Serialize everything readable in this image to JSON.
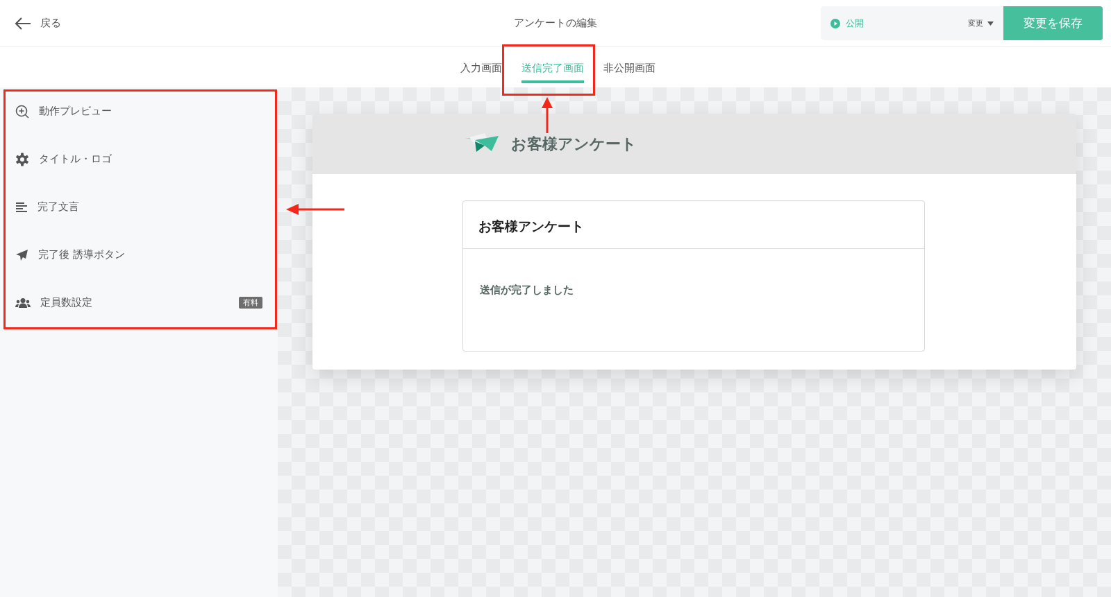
{
  "header": {
    "back": "戻る",
    "title": "アンケートの編集",
    "status": {
      "label": "公開",
      "change": "変更"
    },
    "save": "変更を保存"
  },
  "tabs": [
    {
      "label": "入力画面",
      "selected": false
    },
    {
      "label": "送信完了画面",
      "selected": true
    },
    {
      "label": "非公開画面",
      "selected": false
    }
  ],
  "sidebar": {
    "items": [
      {
        "kind": "preview",
        "label": "動作プレビュー"
      },
      {
        "kind": "settings",
        "label": "タイトル・ロゴ"
      },
      {
        "kind": "text",
        "label": "完了文言"
      },
      {
        "kind": "send",
        "label": "完了後 誘導ボタン"
      },
      {
        "kind": "people",
        "label": "定員数設定",
        "badge": "有料"
      }
    ]
  },
  "preview": {
    "brand": "お客様アンケート",
    "card_title": "お客様アンケート",
    "message": "送信が完了しました"
  }
}
